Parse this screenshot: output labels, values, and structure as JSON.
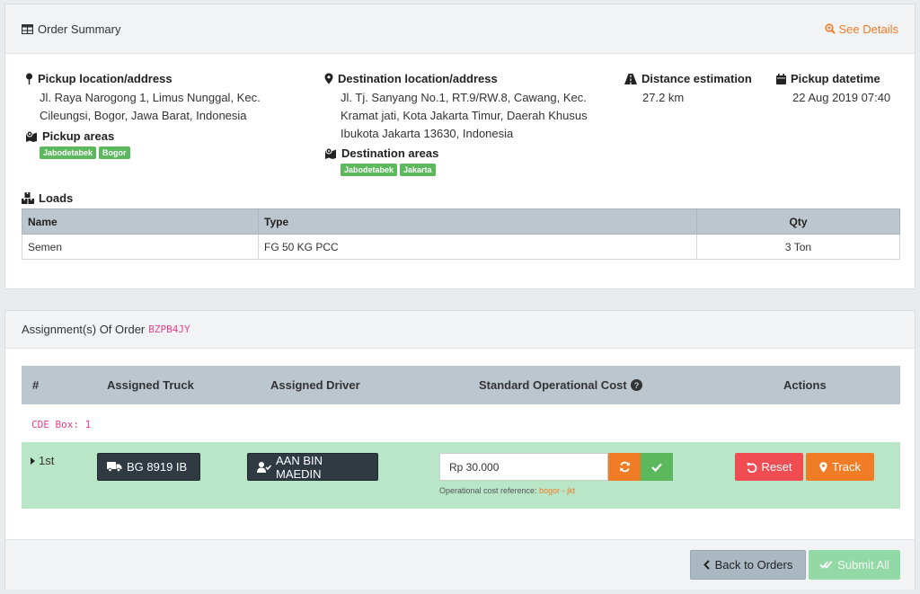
{
  "summary": {
    "title": "Order Summary",
    "see_details": "See Details",
    "pickup": {
      "label": "Pickup location/address",
      "address_line1": "Jl. Raya Narogong 1, Limus Nunggal, Kec.",
      "address_line2": "Cileungsi, Bogor, Jawa Barat, Indonesia",
      "areas_label": "Pickup areas",
      "areas": [
        "Jabodetabek",
        "Bogor"
      ]
    },
    "destination": {
      "label": "Destination location/address",
      "address_line1": "Jl. Tj. Sanyang No.1, RT.9/RW.8, Cawang, Kec.",
      "address_line2": "Kramat jati, Kota Jakarta Timur, Daerah Khusus",
      "address_line3": "Ibukota Jakarta 13630, Indonesia",
      "areas_label": "Destination areas",
      "areas": [
        "Jabodetabek",
        "Jakarta"
      ]
    },
    "distance": {
      "label": "Distance estimation",
      "value": "27.2 km"
    },
    "pickup_datetime": {
      "label": "Pickup datetime",
      "value": "22 Aug 2019 07:40"
    },
    "loads": {
      "label": "Loads",
      "headers": [
        "Name",
        "Type",
        "Qty"
      ],
      "rows": [
        {
          "name": "Semen",
          "type": "FG 50 KG PCC",
          "qty": "3 Ton"
        }
      ]
    }
  },
  "assignments": {
    "title": "Assignment(s) Of Order",
    "order_code": "BZPB4JY",
    "headers": {
      "num": "#",
      "truck": "Assigned Truck",
      "driver": "Assigned Driver",
      "cost": "Standard Operational Cost",
      "actions": "Actions"
    },
    "cde_box": "CDE Box: 1",
    "rows": [
      {
        "index": "1st",
        "truck": "BG 8919 IB",
        "driver": "AAN BIN MAEDIN",
        "cost_value": "Rp 30.000",
        "cost_ref_label": "Operational cost reference:",
        "cost_ref_value": "bogor - jkt",
        "reset_label": "Reset",
        "track_label": "Track"
      }
    ],
    "back_label": "Back to Orders",
    "submit_label": "Submit All"
  },
  "colors": {
    "accent_orange": "#f07c26",
    "success_green": "#5cb85c",
    "danger_red": "#ef4d52",
    "dark": "#2f3a43",
    "row_green": "#b8e6c6",
    "code_pink": "#e83e8c"
  }
}
